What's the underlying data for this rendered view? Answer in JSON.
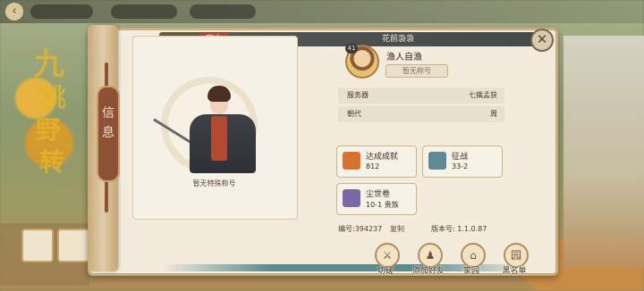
{
  "background": {
    "back_icon": "arrow-left-icon",
    "big_chars": [
      "九",
      "桃",
      "野",
      "转"
    ]
  },
  "header": {
    "official_tag": "官方",
    "band_title": "花前袅袅",
    "close_icon": "close-icon",
    "close_symbol": "✕"
  },
  "sidebar": {
    "tab_label": "信\n息"
  },
  "left_page": {
    "title_caption": "暂无特殊称号"
  },
  "profile": {
    "level": "41",
    "name": "渔人自渔",
    "title_pill": "暂无称号",
    "rows": [
      {
        "key": "服务器",
        "value": "七擒孟获"
      },
      {
        "key": "朝代",
        "value": "周"
      }
    ],
    "stats": [
      {
        "label": "达成成就",
        "value": "812",
        "icon": "achievement-icon",
        "color": "#d5722f"
      },
      {
        "label": "征战",
        "value": "33-2",
        "icon": "battle-icon",
        "color": "#5f8a95"
      },
      {
        "label": "尘世卷",
        "value": "10-1 贵族",
        "icon": "scroll-icon",
        "color": "#7a67a6"
      }
    ],
    "id_text": "编号:394237",
    "copy_label": "复制",
    "version_text": "版本号: 1.1.0.87"
  },
  "actions": [
    {
      "label": "切磋",
      "icon": "spar-icon",
      "glyph": "⚔"
    },
    {
      "label": "添加好友",
      "icon": "add-friend-icon",
      "glyph": "♟"
    },
    {
      "label": "家园",
      "icon": "home-icon",
      "glyph": "⌂"
    },
    {
      "label": "黑名单",
      "icon": "blacklist-icon",
      "glyph": "园"
    }
  ]
}
